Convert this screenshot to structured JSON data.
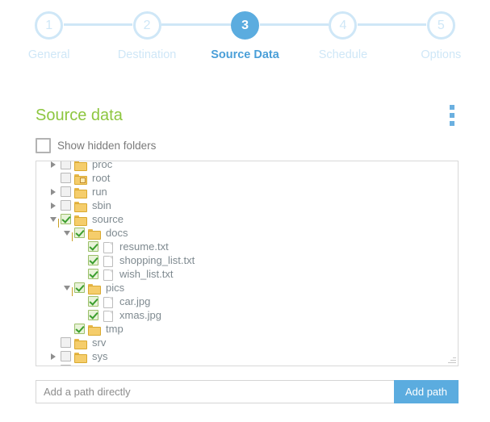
{
  "colors": {
    "accent_blue": "#5bacdf",
    "inactive_blue": "#cfe7f7",
    "active_label_blue": "#4a9fd8",
    "heading_green": "#8dc63f",
    "checkbox_green": "#3a9e2e",
    "folder_yellow": "#f5cd6b",
    "text_gray": "#7f8a90",
    "border_gray": "#d8d8d8"
  },
  "stepper": {
    "steps": [
      {
        "number": "1",
        "label": "General",
        "active": false
      },
      {
        "number": "2",
        "label": "Destination",
        "active": false
      },
      {
        "number": "3",
        "label": "Source Data",
        "active": true
      },
      {
        "number": "4",
        "label": "Schedule",
        "active": false
      },
      {
        "number": "5",
        "label": "Options",
        "active": false
      }
    ]
  },
  "section": {
    "title": "Source data",
    "menu_icon": "kebab-menu-icon"
  },
  "options": {
    "show_hidden_folders": {
      "label": "Show hidden folders",
      "checked": false
    }
  },
  "tree": {
    "nodes": [
      {
        "name": "proc",
        "type": "folder",
        "indent": 1,
        "arrow": "collapsed",
        "checked": false,
        "clipped": true
      },
      {
        "name": "root",
        "type": "folder-special",
        "indent": 1,
        "arrow": "none",
        "checked": false
      },
      {
        "name": "run",
        "type": "folder",
        "indent": 1,
        "arrow": "collapsed",
        "checked": false
      },
      {
        "name": "sbin",
        "type": "folder",
        "indent": 1,
        "arrow": "collapsed",
        "checked": false
      },
      {
        "name": "source",
        "type": "folder",
        "indent": 1,
        "arrow": "expanded",
        "checked": true
      },
      {
        "name": "docs",
        "type": "folder",
        "indent": 2,
        "arrow": "expanded",
        "checked": true
      },
      {
        "name": "resume.txt",
        "type": "file",
        "indent": 3,
        "arrow": "none",
        "checked": true
      },
      {
        "name": "shopping_list.txt",
        "type": "file",
        "indent": 3,
        "arrow": "none",
        "checked": true
      },
      {
        "name": "wish_list.txt",
        "type": "file",
        "indent": 3,
        "arrow": "none",
        "checked": true
      },
      {
        "name": "pics",
        "type": "folder",
        "indent": 2,
        "arrow": "expanded",
        "checked": true
      },
      {
        "name": "car.jpg",
        "type": "file",
        "indent": 3,
        "arrow": "none",
        "checked": true
      },
      {
        "name": "xmas.jpg",
        "type": "file",
        "indent": 3,
        "arrow": "none",
        "checked": true
      },
      {
        "name": "tmp",
        "type": "folder",
        "indent": 2,
        "arrow": "none",
        "checked": true
      },
      {
        "name": "srv",
        "type": "folder",
        "indent": 1,
        "arrow": "none",
        "checked": false
      },
      {
        "name": "sys",
        "type": "folder",
        "indent": 1,
        "arrow": "collapsed",
        "checked": false
      },
      {
        "name": "",
        "type": "folder",
        "indent": 1,
        "arrow": "collapsed",
        "checked": false,
        "clipped": true
      }
    ]
  },
  "footer": {
    "path_input": {
      "value": "",
      "placeholder": "Add a path directly"
    },
    "add_button_label": "Add path"
  }
}
